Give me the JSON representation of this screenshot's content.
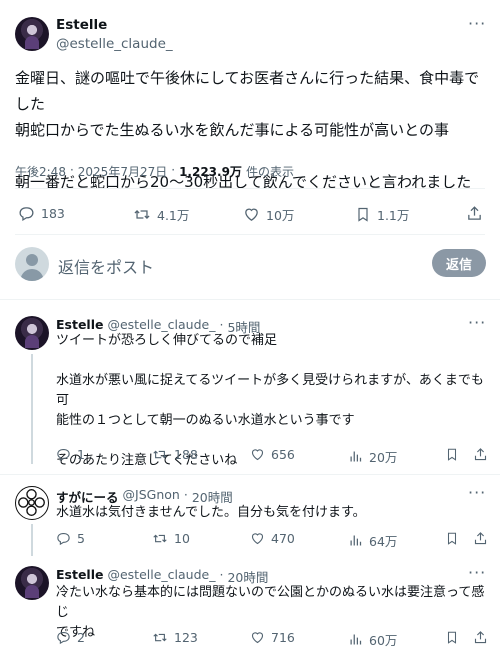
{
  "main_tweet": {
    "author": {
      "name": "Estelle",
      "handle": "@estelle_claude_"
    },
    "more_label": "···",
    "text": "金曜日、謎の嘔吐で午後休にしてお医者さんに行った結果、食中毒でした\n朝蛇口からでた生ぬるい水を飲んだ事による可能性が高いとの事\n\n朝一番だと蛇口から20〜30秒出して飲んでくださいと言われました",
    "meta": {
      "time": "午後2:48",
      "sep1": "·",
      "date": "2025年7月27日",
      "sep2": "·",
      "views": "1,223.9万",
      "views_suffix": "件の表示"
    },
    "stats": {
      "replies": "183",
      "retweets": "4.1万",
      "likes": "10万",
      "bookmarks": "1.1万"
    }
  },
  "reply_composer": {
    "placeholder": "返信をポスト",
    "button_label": "返信"
  },
  "replies": [
    {
      "name": "Estelle",
      "handle": "@estelle_claude_",
      "sep": "·",
      "time": "5時間",
      "text": "ツイートが恐ろしく伸びてるので補足\n\n水道水が悪い風に捉えてるツイートが多く見受けられますが、あくまでも可\n能性の１つとして朝一のぬるい水道水という事です\n\nそのあたり注意してくださいね",
      "stats": {
        "replies": "1",
        "retweets": "188",
        "likes": "656",
        "views": "20万"
      }
    },
    {
      "name": "すがにーる",
      "handle": "@JSGnon",
      "sep": "·",
      "time": "20時間",
      "text": "水道水は気付きませんでした。自分も気を付けます。",
      "stats": {
        "replies": "5",
        "retweets": "10",
        "likes": "470",
        "views": "64万"
      }
    },
    {
      "name": "Estelle",
      "handle": "@estelle_claude_",
      "sep": "·",
      "time": "20時間",
      "text": "冷たい水なら基本的には問題ないので公園とかのぬるい水は要注意って感じ\nですね",
      "stats": {
        "replies": "2",
        "retweets": "123",
        "likes": "716",
        "views": "60万"
      }
    }
  ],
  "icons": {
    "reply": "reply-icon",
    "retweet": "retweet-icon",
    "like": "heart-icon",
    "bookmark": "bookmark-icon",
    "share": "share-icon",
    "views": "views-icon",
    "more": "more-icon"
  },
  "colors": {
    "text": "#0f1419",
    "muted": "#536471",
    "divider": "#eff3f4",
    "reply_button": "#8b98a5"
  }
}
